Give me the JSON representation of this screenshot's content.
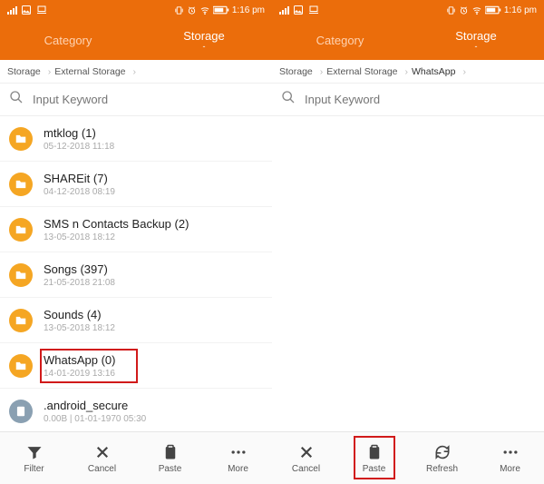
{
  "status": {
    "time": "1:16 pm"
  },
  "tabs": {
    "category": "Category",
    "storage": "Storage",
    "sub": "-"
  },
  "breadcrumb_left": [
    "Storage",
    "External Storage"
  ],
  "breadcrumb_right": [
    "Storage",
    "External Storage",
    "WhatsApp"
  ],
  "search": {
    "placeholder": "Input Keyword"
  },
  "items": [
    {
      "name": "mtklog (1)",
      "sub": "05-12-2018 11:18"
    },
    {
      "name": "SHAREit (7)",
      "sub": "04-12-2018 08:19"
    },
    {
      "name": "SMS n Contacts Backup (2)",
      "sub": "13-05-2018 18:12"
    },
    {
      "name": "Songs (397)",
      "sub": "21-05-2018 21:08"
    },
    {
      "name": "Sounds (4)",
      "sub": "13-05-2018 18:12"
    },
    {
      "name": "WhatsApp (0)",
      "sub": "14-01-2019 13:16"
    },
    {
      "name": ".android_secure",
      "sub": "0.00B | 01-01-1970 05:30"
    }
  ],
  "actions": {
    "filter": "Filter",
    "cancel": "Cancel",
    "paste": "Paste",
    "more": "More",
    "refresh": "Refresh"
  }
}
